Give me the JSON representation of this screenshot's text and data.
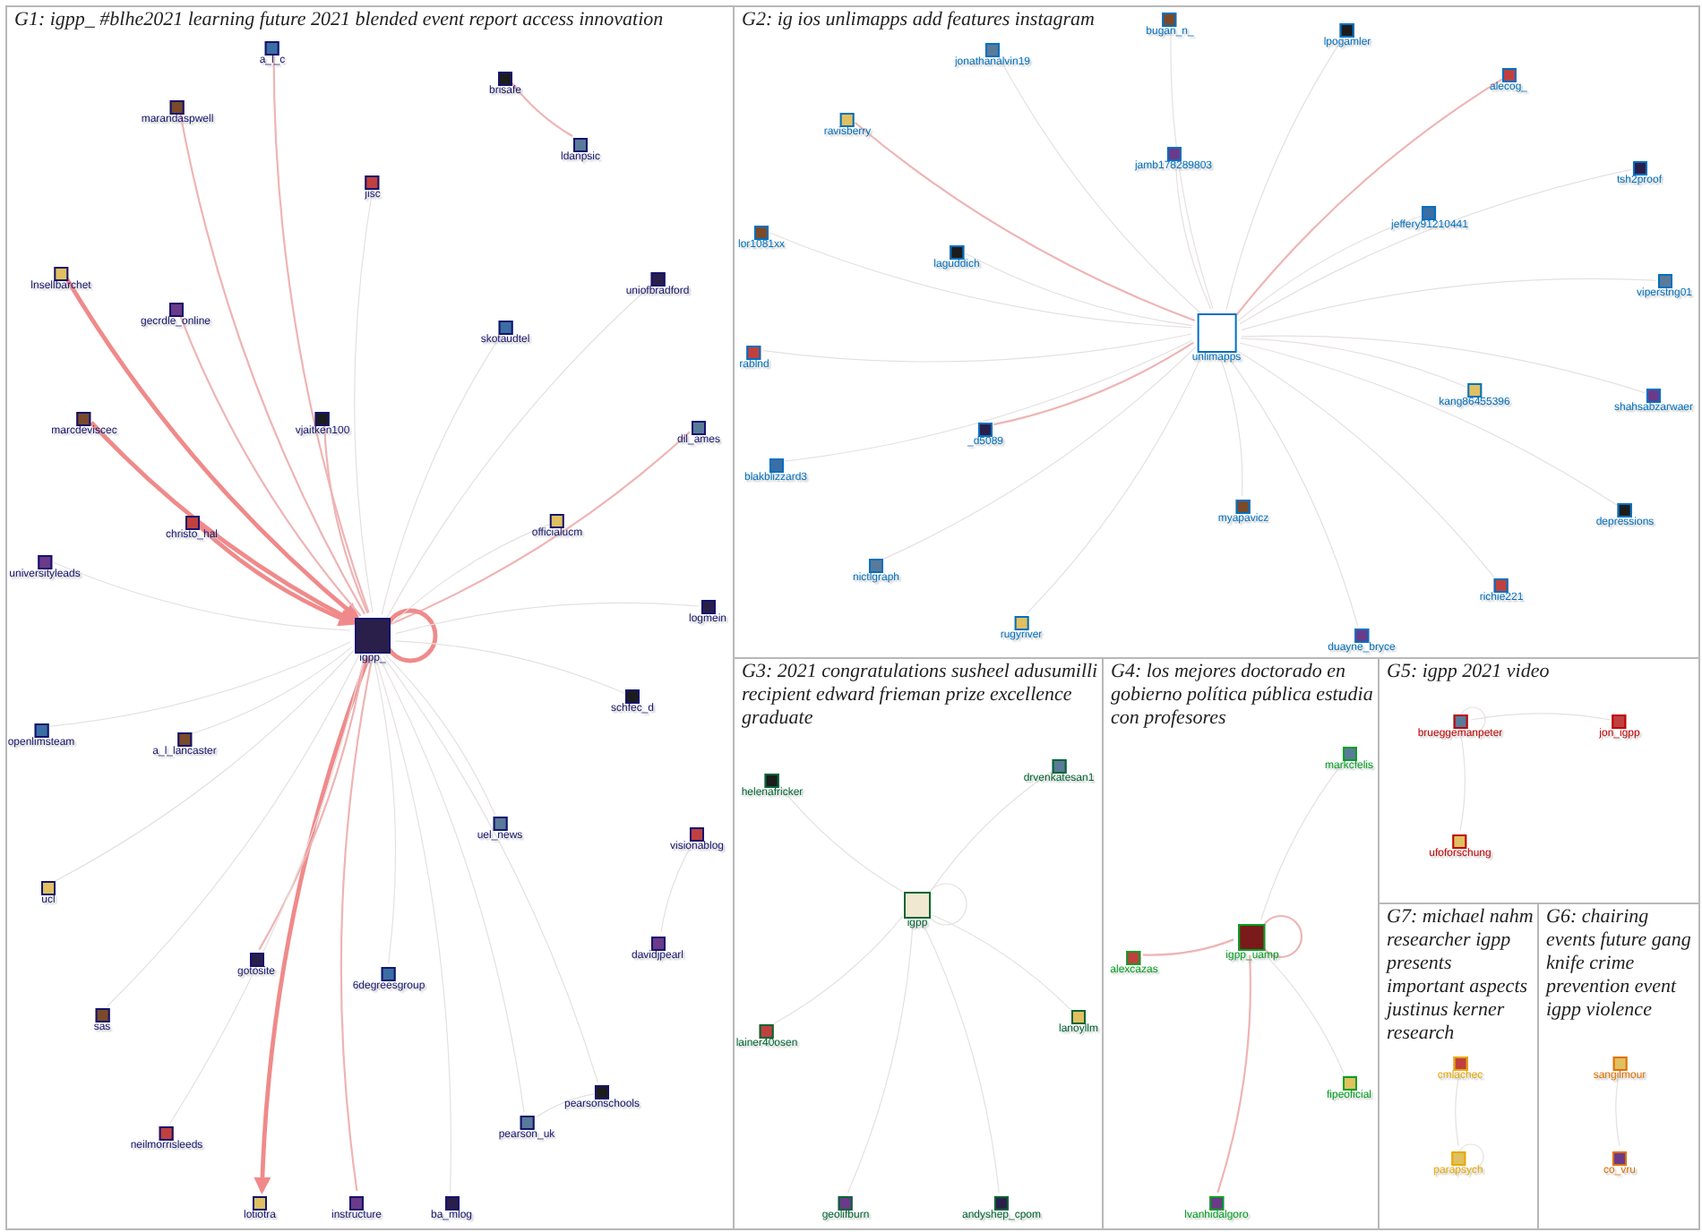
{
  "groups": [
    {
      "title": "G1: igpp_ #blhe2021 learning future 2021 blended event report access innovation",
      "color": "#14146e",
      "nodes": [
        {
          "label": "igpp_",
          "kind": "hub"
        },
        {
          "label": "a_l_c",
          "kind": "user"
        },
        {
          "label": "marandaspwell",
          "kind": "user"
        },
        {
          "label": "brisafe",
          "kind": "user"
        },
        {
          "label": "ldanpsic",
          "kind": "user"
        },
        {
          "label": "jisc",
          "kind": "user"
        },
        {
          "label": "lnsellbarchet",
          "kind": "user"
        },
        {
          "label": "gecrdle_online",
          "kind": "user"
        },
        {
          "label": "uniofbradford",
          "kind": "user"
        },
        {
          "label": "skotaudtel",
          "kind": "user"
        },
        {
          "label": "marcdeviscec",
          "kind": "user"
        },
        {
          "label": "vjaitken100",
          "kind": "user"
        },
        {
          "label": "dil_ames",
          "kind": "user"
        },
        {
          "label": "christo_hal",
          "kind": "user"
        },
        {
          "label": "officialucm",
          "kind": "user"
        },
        {
          "label": "universityleads",
          "kind": "user"
        },
        {
          "label": "logmein",
          "kind": "user"
        },
        {
          "label": "openlimsteam",
          "kind": "user"
        },
        {
          "label": "a_l_lancaster",
          "kind": "user"
        },
        {
          "label": "schfec_d",
          "kind": "user"
        },
        {
          "label": "uel_news",
          "kind": "user"
        },
        {
          "label": "visionablog",
          "kind": "user"
        },
        {
          "label": "ucl",
          "kind": "user"
        },
        {
          "label": "davidjpearl",
          "kind": "user"
        },
        {
          "label": "gotosite",
          "kind": "user"
        },
        {
          "label": "6degreesgroup",
          "kind": "user"
        },
        {
          "label": "sas",
          "kind": "user"
        },
        {
          "label": "pearsonschools",
          "kind": "user"
        },
        {
          "label": "pearson_uk",
          "kind": "user"
        },
        {
          "label": "neilmorrisleeds",
          "kind": "user"
        },
        {
          "label": "lotiotra",
          "kind": "user"
        },
        {
          "label": "instructure",
          "kind": "user"
        },
        {
          "label": "ba_mlog",
          "kind": "user"
        }
      ]
    },
    {
      "title": "G2: ig ios unlimapps add features instagram",
      "color": "#0070c0",
      "nodes": [
        {
          "label": "unlimapps",
          "kind": "hub"
        },
        {
          "label": "bugan_n_",
          "kind": "user"
        },
        {
          "label": "lpogamler",
          "kind": "user"
        },
        {
          "label": "jonathanalvin19",
          "kind": "user"
        },
        {
          "label": "alecog_",
          "kind": "user"
        },
        {
          "label": "ravisberry",
          "kind": "user"
        },
        {
          "label": "jamb178289803",
          "kind": "user"
        },
        {
          "label": "tsh2proof",
          "kind": "user"
        },
        {
          "label": "jeffery91210441",
          "kind": "user"
        },
        {
          "label": "lor1081xx",
          "kind": "user"
        },
        {
          "label": "laguddich",
          "kind": "user"
        },
        {
          "label": "viperstng01",
          "kind": "user"
        },
        {
          "label": "rablnd",
          "kind": "user"
        },
        {
          "label": "kang86455396",
          "kind": "user"
        },
        {
          "label": "shahsabzarwaer",
          "kind": "user"
        },
        {
          "label": "_d5089",
          "kind": "user"
        },
        {
          "label": "blakblizzard3",
          "kind": "user"
        },
        {
          "label": "myapavicz",
          "kind": "user"
        },
        {
          "label": "depressions",
          "kind": "user"
        },
        {
          "label": "nictlgraph",
          "kind": "user"
        },
        {
          "label": "richie221",
          "kind": "user"
        },
        {
          "label": "rugyriver",
          "kind": "user"
        },
        {
          "label": "duayne_bryce",
          "kind": "user"
        }
      ]
    },
    {
      "title": "G3: 2021 congratulations susheel adusumilli recipient edward frieman prize excellence graduate",
      "color": "#006633",
      "nodes": [
        {
          "label": "igpp",
          "kind": "hub"
        },
        {
          "label": "helenafricker",
          "kind": "user"
        },
        {
          "label": "drvenkatesan1",
          "kind": "user"
        },
        {
          "label": "lainer40osen",
          "kind": "user"
        },
        {
          "label": "lanoyllm",
          "kind": "user"
        },
        {
          "label": "geolifburn",
          "kind": "user"
        },
        {
          "label": "andyshep_cpom",
          "kind": "user"
        }
      ]
    },
    {
      "title": "G4: los mejores doctorado en gobierno política pública estudia con profesores",
      "color": "#00a020",
      "nodes": [
        {
          "label": "igpp_uamp",
          "kind": "hub"
        },
        {
          "label": "markcfelis",
          "kind": "user"
        },
        {
          "label": "alexcazas",
          "kind": "user"
        },
        {
          "label": "fipeoficial",
          "kind": "user"
        },
        {
          "label": "lvanhidalgoro",
          "kind": "user"
        }
      ]
    },
    {
      "title": "G5: igpp 2021 video",
      "color": "#c00000",
      "nodes": [
        {
          "label": "brueggemanpeter",
          "kind": "user"
        },
        {
          "label": "jon_igpp",
          "kind": "user"
        },
        {
          "label": "ufoforschung",
          "kind": "user"
        }
      ]
    },
    {
      "title": "G7: michael nahm researcher igpp presents important aspects justinus kerner research",
      "color": "#e8a800",
      "nodes": [
        {
          "label": "cmlachec",
          "kind": "user"
        },
        {
          "label": "parapsych",
          "kind": "user"
        }
      ]
    },
    {
      "title": "G6: chairing events future gang knife crime prevention event igpp violence",
      "color": "#e07000",
      "nodes": [
        {
          "label": "sangilmour",
          "kind": "user"
        },
        {
          "label": "co_vru",
          "kind": "user"
        }
      ]
    }
  ]
}
